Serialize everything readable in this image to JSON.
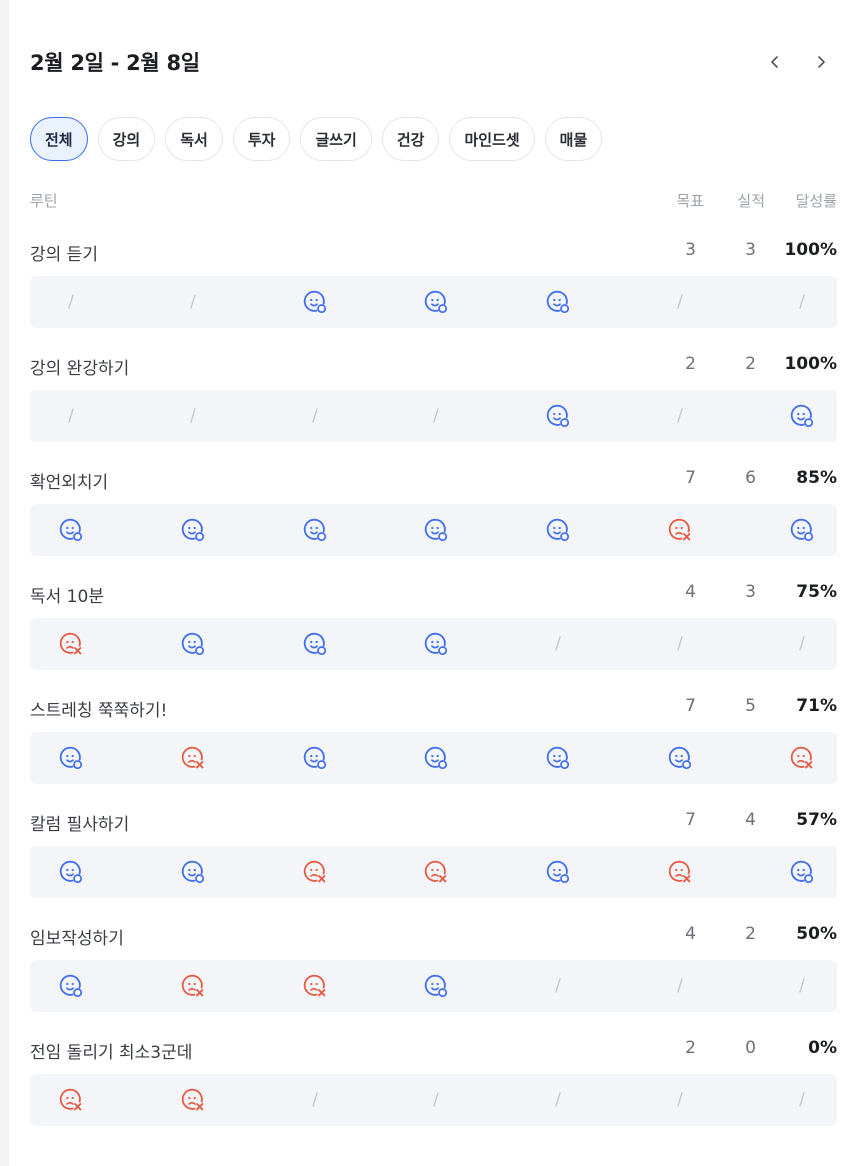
{
  "header": {
    "title": "2월 2일 - 2월 8일",
    "prev_icon": "chevron-left-icon",
    "next_icon": "chevron-right-icon"
  },
  "tabs": [
    {
      "label": "전체",
      "active": true
    },
    {
      "label": "강의"
    },
    {
      "label": "독서"
    },
    {
      "label": "투자"
    },
    {
      "label": "글쓰기"
    },
    {
      "label": "건강"
    },
    {
      "label": "마인드셋"
    },
    {
      "label": "매물"
    }
  ],
  "table_header": {
    "routine": "루틴",
    "goal": "목표",
    "actual": "실적",
    "rate": "달성률"
  },
  "status_legend": {
    "done": "smile-face-icon",
    "missed": "sad-face-icon",
    "none": "/"
  },
  "colors": {
    "accent": "#3a6ef5",
    "done": "#3f6df0",
    "missed": "#e65b43",
    "none": "#c3c7ce"
  },
  "routines": [
    {
      "name": "강의 듣기",
      "goal": "3",
      "actual": "3",
      "rate": "100%",
      "days": [
        "none",
        "none",
        "done",
        "done",
        "done",
        "none",
        "none"
      ]
    },
    {
      "name": "강의 완강하기",
      "goal": "2",
      "actual": "2",
      "rate": "100%",
      "days": [
        "none",
        "none",
        "none",
        "none",
        "done",
        "none",
        "done"
      ]
    },
    {
      "name": "확언외치기",
      "goal": "7",
      "actual": "6",
      "rate": "85%",
      "days": [
        "done",
        "done",
        "done",
        "done",
        "done",
        "missed",
        "done"
      ]
    },
    {
      "name": "독서 10분",
      "goal": "4",
      "actual": "3",
      "rate": "75%",
      "days": [
        "missed",
        "done",
        "done",
        "done",
        "none",
        "none",
        "none"
      ]
    },
    {
      "name": "스트레칭 쭉쭉하기!",
      "goal": "7",
      "actual": "5",
      "rate": "71%",
      "days": [
        "done",
        "missed",
        "done",
        "done",
        "done",
        "done",
        "missed"
      ]
    },
    {
      "name": "칼럼 필사하기",
      "goal": "7",
      "actual": "4",
      "rate": "57%",
      "days": [
        "done",
        "done",
        "missed",
        "missed",
        "done",
        "missed",
        "done"
      ]
    },
    {
      "name": "임보작성하기",
      "goal": "4",
      "actual": "2",
      "rate": "50%",
      "days": [
        "done",
        "missed",
        "missed",
        "done",
        "none",
        "none",
        "none"
      ]
    },
    {
      "name": "전임 돌리기 최소3군데",
      "goal": "2",
      "actual": "0",
      "rate": "0%",
      "days": [
        "missed",
        "missed",
        "none",
        "none",
        "none",
        "none",
        "none"
      ]
    }
  ]
}
